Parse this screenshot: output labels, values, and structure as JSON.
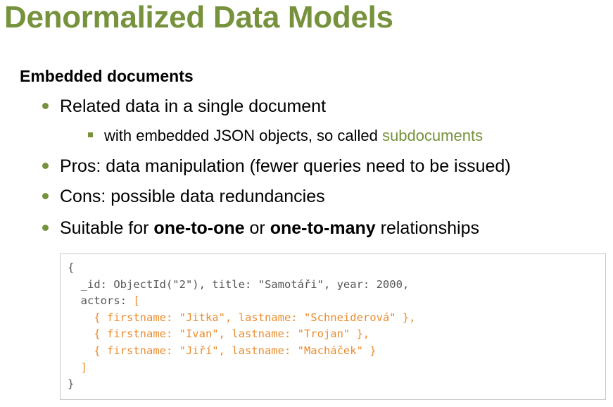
{
  "slide": {
    "title": "Denormalized Data Models",
    "section_heading": "Embedded documents"
  },
  "bullets": {
    "b1": "Related data in a single document",
    "b1_sub_prefix": "with embedded JSON objects, so called ",
    "b1_sub_highlight": "subdocuments",
    "b2": "Pros: data manipulation (fewer queries need to be issued)",
    "b3": "Cons: possible data redundancies",
    "b4_part1": "Suitable for ",
    "b4_bold1": "one-to-one",
    "b4_part2": " or ",
    "b4_bold2": "one-to-many",
    "b4_part3": " relationships"
  },
  "code": {
    "open_brace": "{",
    "line_id": "  _id: ObjectId(\"2\"), title: \"Samotáři\", year: 2000,",
    "actors_key": "  actors: ",
    "actors_open": "[",
    "actor1": "    { firstname: \"Jitka\", lastname: \"Schneiderová\" },",
    "actor2": "    { firstname: \"Ivan\", lastname: \"Trojan\" },",
    "actor3": "    { firstname: \"Jiří\", lastname: \"Macháček\" }",
    "actors_close": "  ]",
    "close_brace": "}"
  },
  "colors": {
    "accent_green": "#76923c",
    "code_orange": "#e98c2e",
    "code_gray": "#555555"
  }
}
